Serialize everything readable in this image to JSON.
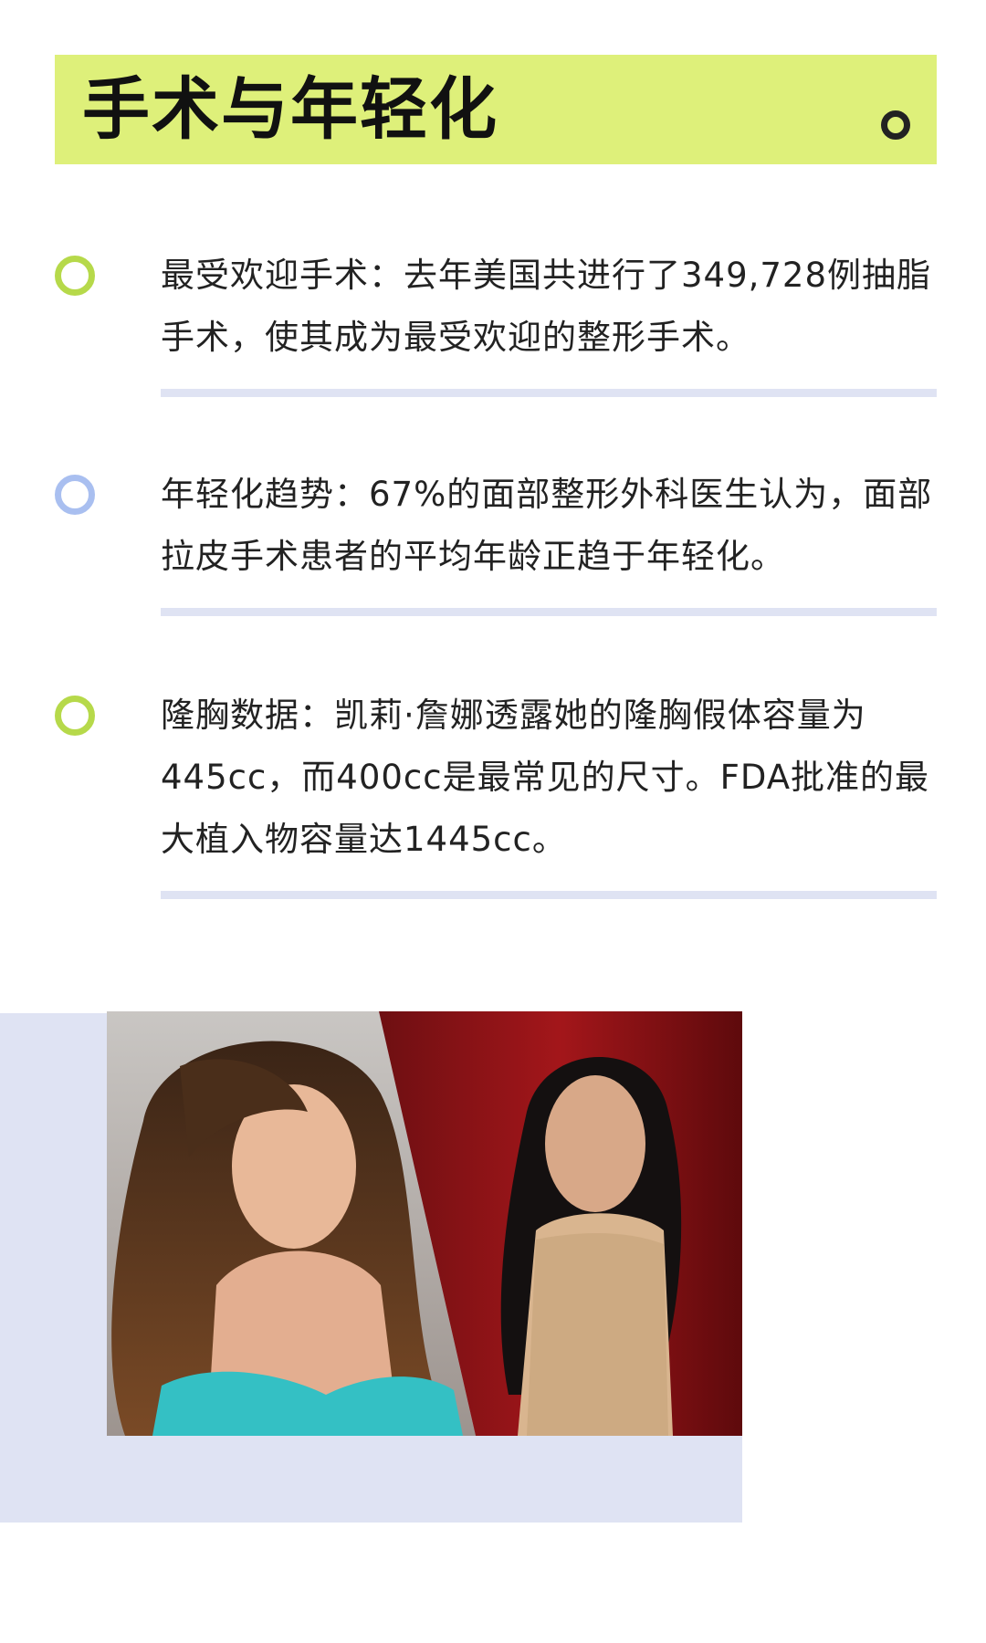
{
  "header": {
    "title": "手术与年轻化"
  },
  "items": [
    {
      "text": "最受欢迎手术：去年美国共进行了349,728例抽脂手术，使其成为最受欢迎的整形手术。",
      "dot_color": "#b6d94a"
    },
    {
      "text": "年轻化趋势：67%的面部整形外科医生认为，面部拉皮手术患者的平均年龄正趋于年轻化。",
      "dot_color": "#a9bff0"
    },
    {
      "text": "隆胸数据：凯莉·詹娜透露她的隆胸假体容量为445cc，而400cc是最常见的尺寸。FDA批准的最大植入物容量达1445cc。",
      "dot_color": "#b6d94a"
    }
  ],
  "colors": {
    "header_bg": "#def07a",
    "divider": "#dfe3f3",
    "photo_bg": "#dfe3f3"
  }
}
